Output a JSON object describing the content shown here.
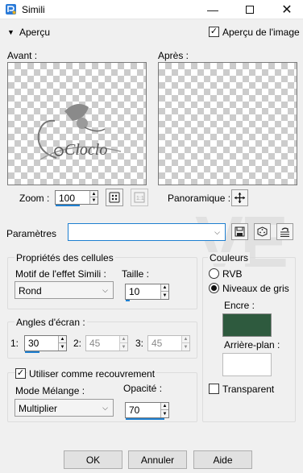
{
  "window": {
    "title": "Simili",
    "minimize_icon": "minimize-icon",
    "maximize_icon": "maximize-icon",
    "close_icon": "close-icon"
  },
  "apercu": {
    "toggle_label": "Aperçu",
    "image_preview_label": "Aperçu de l'image",
    "image_preview_checked": true
  },
  "previews": {
    "avant_label": "Avant :",
    "apres_label": "Après :",
    "logo_text": "Cloclo"
  },
  "zoom": {
    "label": "Zoom :",
    "value": "100"
  },
  "panoramique": {
    "label": "Panoramique :"
  },
  "parametres": {
    "label": "Paramètres",
    "value": ""
  },
  "cell_props": {
    "group_label": "Propriétés des cellules",
    "effect_label": "Motif de l'effet Simili :",
    "effect_value": "Rond",
    "size_label": "Taille :",
    "size_value": "10"
  },
  "angles": {
    "group_label": "Angles d'écran :",
    "a1_label": "1:",
    "a1_value": "30",
    "a2_label": "2:",
    "a2_value": "45",
    "a3_label": "3:",
    "a3_value": "45"
  },
  "overlay": {
    "checkbox_label": "Utiliser comme recouvrement",
    "checked": true,
    "blend_label": "Mode Mélange :",
    "blend_value": "Multiplier",
    "opacity_label": "Opacité :",
    "opacity_value": "70"
  },
  "couleurs": {
    "group_label": "Couleurs",
    "rvb_label": "RVB",
    "gris_label": "Niveaux de gris",
    "selected": "Niveaux de gris",
    "encre_label": "Encre :",
    "encre_color": "#2e5a3e",
    "fond_label": "Arrière-plan :",
    "fond_color": "#ffffff",
    "transparent_label": "Transparent",
    "transparent_checked": false
  },
  "buttons": {
    "ok": "OK",
    "annuler": "Annuler",
    "aide": "Aide"
  }
}
